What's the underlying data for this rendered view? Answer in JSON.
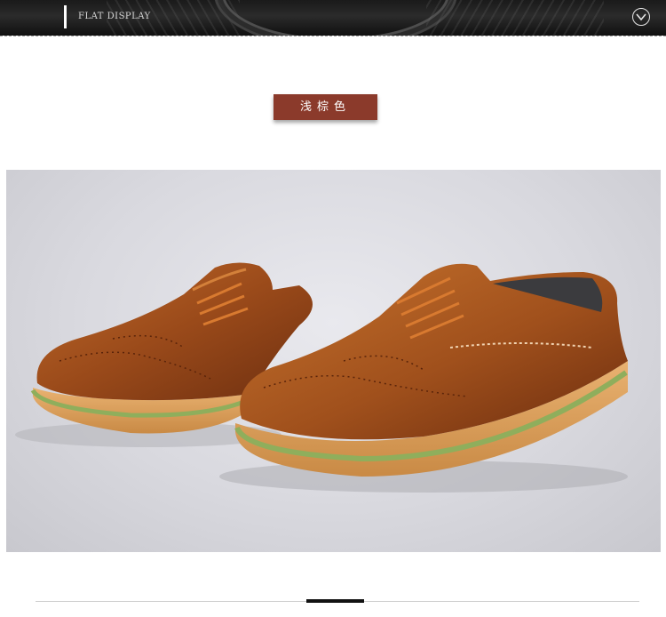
{
  "header": {
    "title": "FLAT DISPLAY",
    "toggle_icon": "chevron-down-circle-icon"
  },
  "color_tag": {
    "label": "浅棕色",
    "background": "#8b3a2b"
  },
  "photo": {
    "subject": "shoe-pair-image"
  }
}
